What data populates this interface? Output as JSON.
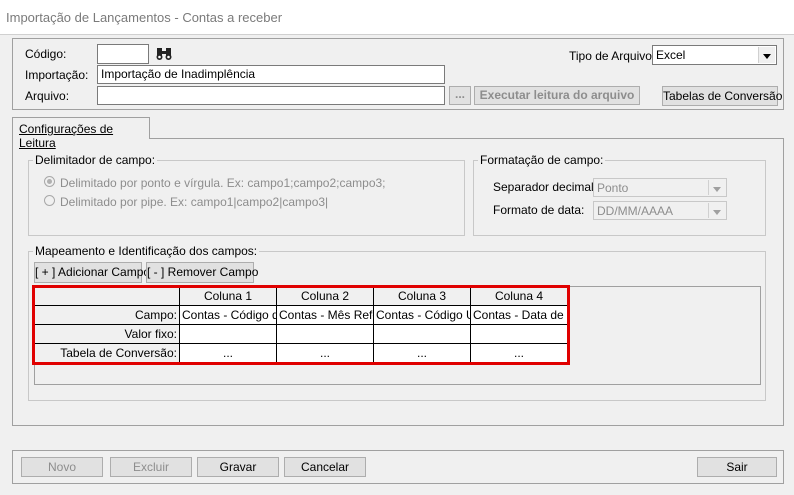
{
  "window": {
    "title": "Importação de Lançamentos - Contas a receber"
  },
  "form": {
    "codigo_label": "Código:",
    "codigo_value": "",
    "importacao_label": "Importação:",
    "importacao_value": "Importação de Inadimplência",
    "arquivo_label": "Arquivo:",
    "arquivo_value": "",
    "browse_label": "...",
    "executar_label": "Executar leitura do arquivo",
    "tipo_label": "Tipo de Arquivo:",
    "tipo_value": "Excel",
    "tabelas_label": "Tabelas de Conversão"
  },
  "tabs": [
    {
      "label": "Configurações de Leitura"
    }
  ],
  "delimitador": {
    "legend": "Delimitador de campo:",
    "options": [
      {
        "label": "Delimitado por ponto e vírgula. Ex: campo1;campo2;campo3;",
        "selected": true
      },
      {
        "label": "Delimitado por pipe. Ex: campo1|campo2|campo3|",
        "selected": false
      }
    ]
  },
  "formatacao": {
    "legend": "Formatação de campo:",
    "separador_label": "Separador decimal:",
    "separador_value": "Ponto",
    "formato_label": "Formato de data:",
    "formato_value": "DD/MM/AAAA"
  },
  "mapeamento": {
    "legend": "Mapeamento e Identificação dos campos:",
    "add_label": "[ + ] Adicionar Campo",
    "remove_label": "[ - ] Remover Campo",
    "columns": [
      "Coluna 1",
      "Coluna 2",
      "Coluna 3",
      "Coluna 4"
    ],
    "row_labels": [
      "Campo:",
      "Valor fixo:",
      "Tabela de Conversão:"
    ],
    "campo_values": [
      "Contas - Código do",
      "Contas - Mês Refere",
      "Contas - Código Un",
      "Contas - Data de Ve"
    ],
    "valor_fixo_values": [
      "",
      "",
      "",
      ""
    ],
    "tabela_values": [
      "...",
      "...",
      "...",
      "..."
    ]
  },
  "footer": {
    "novo_label": "Novo",
    "excluir_label": "Excluir",
    "gravar_label": "Gravar",
    "cancelar_label": "Cancelar",
    "sair_label": "Sair"
  },
  "colors": {
    "highlight_border": "#e00000"
  }
}
